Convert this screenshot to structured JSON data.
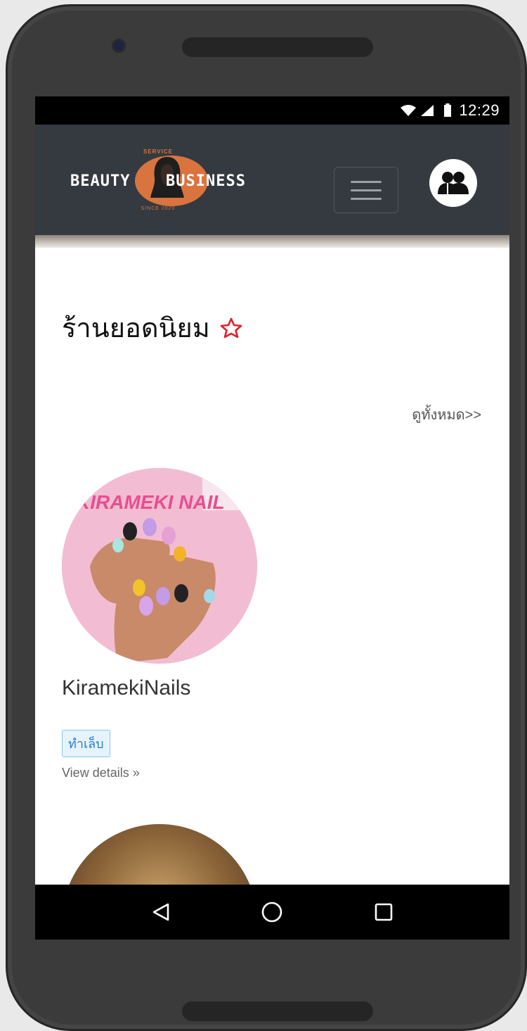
{
  "status_bar": {
    "time": "12:29"
  },
  "navbar": {
    "logo": {
      "top_text": "SERVICE",
      "left_text": "BEAUTY",
      "right_text": "BUSINESS",
      "bottom_text": "SINCE 2020"
    },
    "menu_icon": "hamburger-icon",
    "user_icon": "users-icon"
  },
  "section": {
    "title": "ร้านยอดนิยม",
    "title_icon": "star-outline-icon",
    "view_all": "ดูทั้งหมด>>"
  },
  "shops": [
    {
      "name": "KiramekiNails",
      "image_text": "KIRAMEKI NAIL",
      "tag": "ทำเล็บ",
      "details_link": "View details »"
    },
    {
      "name": "",
      "image_text": ""
    }
  ],
  "android_nav": {
    "back_icon": "back-triangle-icon",
    "home_icon": "home-circle-icon",
    "recents_icon": "recents-square-icon"
  },
  "colors": {
    "navbar_bg": "#343a40",
    "logo_accent": "#d9743f",
    "star": "#e0202a",
    "badge_text": "#2a7fd3"
  }
}
